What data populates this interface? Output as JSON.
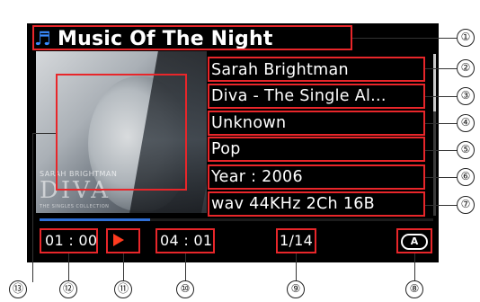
{
  "player": {
    "title": "Music Of The Night",
    "artist": "Sarah Brightman",
    "album": "Diva - The Single Al...",
    "composer": "Unknown",
    "genre": "Pop",
    "year": "Year : 2006",
    "format": "wav 44KHz 2Ch 16B",
    "album_art": {
      "artist_caption": "SARAH BRIGHTMAN",
      "title_text": "DIVA",
      "collection_text": "THE SINGLES COLLECTION"
    },
    "elapsed": "01 : 00",
    "total": "04 : 01",
    "track_position": "1/14",
    "progress_fraction": 0.28,
    "play_state_icon": "play-icon",
    "repeat_icon_letter": "A",
    "note_icon": "♬"
  },
  "colors": {
    "screen_bg": "#000000",
    "callout_box": "#e8262a",
    "play_icon": "#ff3b1f",
    "progress": "#2f6fd6",
    "note_icon": "#3a8bff"
  },
  "callouts": [
    "①",
    "②",
    "③",
    "④",
    "⑤",
    "⑥",
    "⑦",
    "⑧",
    "⑨",
    "⑩",
    "⑪",
    "⑫",
    "⑬"
  ]
}
